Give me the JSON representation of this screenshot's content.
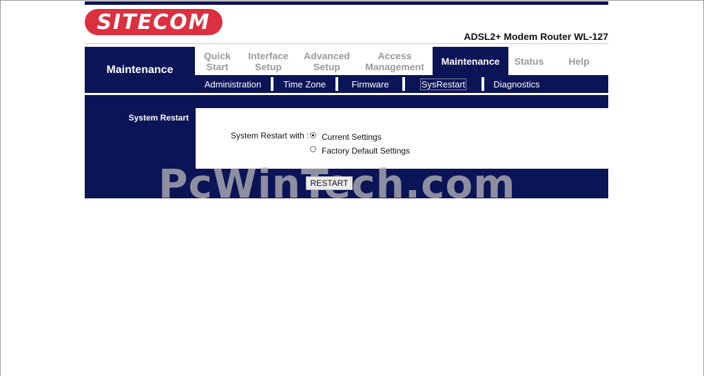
{
  "brand": {
    "logo_text": "SITECOM",
    "model": "ADSL2+ Modem Router WL-127"
  },
  "section": {
    "title": "Maintenance"
  },
  "tabs": [
    {
      "label": "Quick Start",
      "active": false
    },
    {
      "label": "Interface Setup",
      "active": false
    },
    {
      "label": "Advanced Setup",
      "active": false
    },
    {
      "label": "Access Management",
      "active": false
    },
    {
      "label": "Maintenance",
      "active": true
    },
    {
      "label": "Status",
      "active": false
    },
    {
      "label": "Help",
      "active": false
    }
  ],
  "subnav": [
    {
      "label": "Administration",
      "active": false
    },
    {
      "label": "Time Zone",
      "active": false
    },
    {
      "label": "Firmware",
      "active": false
    },
    {
      "label": "SysRestart",
      "active": true
    },
    {
      "label": "Diagnostics",
      "active": false
    }
  ],
  "form": {
    "section_label": "System Restart",
    "field_label": "System Restart with :",
    "options": [
      {
        "label": "Current Settings",
        "selected": true
      },
      {
        "label": "Factory Default Settings",
        "selected": false
      }
    ],
    "button": "RESTART"
  },
  "watermark": "PcWinTech.com",
  "colors": {
    "nav_bg": "#0b1457",
    "logo_red": "#dc2f3f",
    "inactive_tab": "#9a9a9a"
  }
}
